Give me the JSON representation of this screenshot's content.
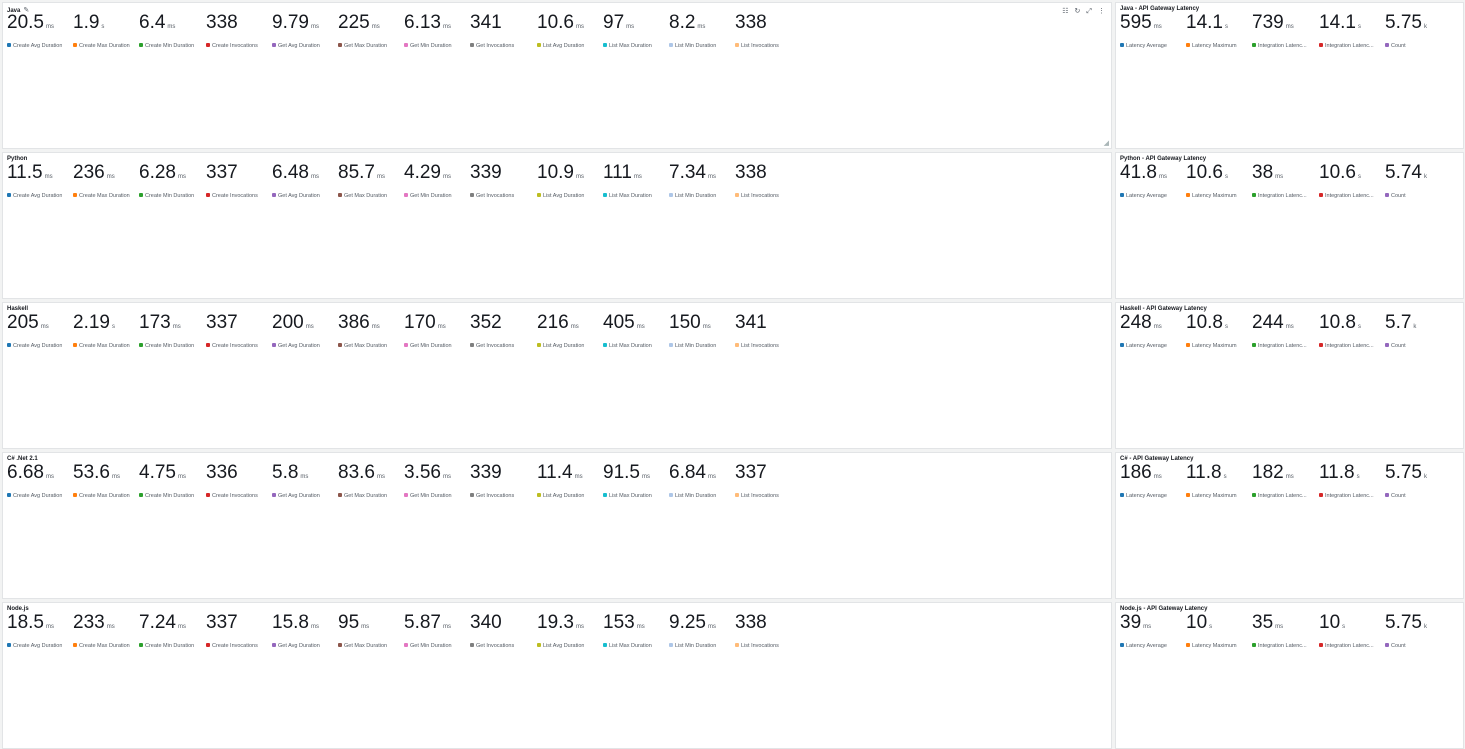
{
  "colors": {
    "c1": "#1f77b4",
    "c2": "#ff7f0e",
    "c3": "#2ca02c",
    "c4": "#d62728",
    "c5": "#9467bd",
    "c6": "#8c564b",
    "c7": "#e377c2",
    "c8": "#7f7f7f",
    "c9": "#bcbd22",
    "c10": "#17becf",
    "c11": "#aec7e8",
    "c12": "#ffbb78"
  },
  "toolbar": {
    "icons": [
      "document-icon",
      "refresh-icon",
      "expand-icon",
      "more-options-icon"
    ],
    "edit_icon": "pencil-icon"
  },
  "lambda_labels": [
    "Create Avg Duration",
    "Create Max Duration",
    "Create Min Duration",
    "Create Invocations",
    "Get Avg Duration",
    "Get Max Duration",
    "Get Min Duration",
    "Get Invocations",
    "List Avg Duration",
    "List Max Duration",
    "List Min Duration",
    "List Invocations"
  ],
  "api_labels": [
    "Latency Average",
    "Latency Maximum",
    "Integration Latenc...",
    "Integration Latenc...",
    "Count"
  ],
  "rows": [
    {
      "lambda": {
        "title": "Java",
        "metrics": [
          {
            "value": "20.5",
            "unit": "ms"
          },
          {
            "value": "1.9",
            "unit": "s"
          },
          {
            "value": "6.4",
            "unit": "ms"
          },
          {
            "value": "338",
            "unit": ""
          },
          {
            "value": "9.79",
            "unit": "ms"
          },
          {
            "value": "225",
            "unit": "ms"
          },
          {
            "value": "6.13",
            "unit": "ms"
          },
          {
            "value": "341",
            "unit": ""
          },
          {
            "value": "10.6",
            "unit": "ms"
          },
          {
            "value": "97",
            "unit": "ms"
          },
          {
            "value": "8.2",
            "unit": "ms"
          },
          {
            "value": "338",
            "unit": ""
          }
        ]
      },
      "api": {
        "title": "Java - API Gateway Latency",
        "metrics": [
          {
            "value": "595",
            "unit": "ms"
          },
          {
            "value": "14.1",
            "unit": "s"
          },
          {
            "value": "739",
            "unit": "ms"
          },
          {
            "value": "14.1",
            "unit": "s"
          },
          {
            "value": "5.75",
            "unit": "k"
          }
        ]
      }
    },
    {
      "lambda": {
        "title": "Python",
        "metrics": [
          {
            "value": "11.5",
            "unit": "ms"
          },
          {
            "value": "236",
            "unit": "ms"
          },
          {
            "value": "6.28",
            "unit": "ms"
          },
          {
            "value": "337",
            "unit": ""
          },
          {
            "value": "6.48",
            "unit": "ms"
          },
          {
            "value": "85.7",
            "unit": "ms"
          },
          {
            "value": "4.29",
            "unit": "ms"
          },
          {
            "value": "339",
            "unit": ""
          },
          {
            "value": "10.9",
            "unit": "ms"
          },
          {
            "value": "111",
            "unit": "ms"
          },
          {
            "value": "7.34",
            "unit": "ms"
          },
          {
            "value": "338",
            "unit": ""
          }
        ]
      },
      "api": {
        "title": "Python - API Gateway Latency",
        "metrics": [
          {
            "value": "41.8",
            "unit": "ms"
          },
          {
            "value": "10.6",
            "unit": "s"
          },
          {
            "value": "38",
            "unit": "ms"
          },
          {
            "value": "10.6",
            "unit": "s"
          },
          {
            "value": "5.74",
            "unit": "k"
          }
        ]
      }
    },
    {
      "lambda": {
        "title": "Haskell",
        "metrics": [
          {
            "value": "205",
            "unit": "ms"
          },
          {
            "value": "2.19",
            "unit": "s"
          },
          {
            "value": "173",
            "unit": "ms"
          },
          {
            "value": "337",
            "unit": ""
          },
          {
            "value": "200",
            "unit": "ms"
          },
          {
            "value": "386",
            "unit": "ms"
          },
          {
            "value": "170",
            "unit": "ms"
          },
          {
            "value": "352",
            "unit": ""
          },
          {
            "value": "216",
            "unit": "ms"
          },
          {
            "value": "405",
            "unit": "ms"
          },
          {
            "value": "150",
            "unit": "ms"
          },
          {
            "value": "341",
            "unit": ""
          }
        ]
      },
      "api": {
        "title": "Haskell - API Gateway Latency",
        "metrics": [
          {
            "value": "248",
            "unit": "ms"
          },
          {
            "value": "10.8",
            "unit": "s"
          },
          {
            "value": "244",
            "unit": "ms"
          },
          {
            "value": "10.8",
            "unit": "s"
          },
          {
            "value": "5.7",
            "unit": "k"
          }
        ]
      }
    },
    {
      "lambda": {
        "title": "C# .Net 2.1",
        "metrics": [
          {
            "value": "6.68",
            "unit": "ms"
          },
          {
            "value": "53.6",
            "unit": "ms"
          },
          {
            "value": "4.75",
            "unit": "ms"
          },
          {
            "value": "336",
            "unit": ""
          },
          {
            "value": "5.8",
            "unit": "ms"
          },
          {
            "value": "83.6",
            "unit": "ms"
          },
          {
            "value": "3.56",
            "unit": "ms"
          },
          {
            "value": "339",
            "unit": ""
          },
          {
            "value": "11.4",
            "unit": "ms"
          },
          {
            "value": "91.5",
            "unit": "ms"
          },
          {
            "value": "6.84",
            "unit": "ms"
          },
          {
            "value": "337",
            "unit": ""
          }
        ]
      },
      "api": {
        "title": "C# - API Gateway Latency",
        "metrics": [
          {
            "value": "186",
            "unit": "ms"
          },
          {
            "value": "11.8",
            "unit": "s"
          },
          {
            "value": "182",
            "unit": "ms"
          },
          {
            "value": "11.8",
            "unit": "s"
          },
          {
            "value": "5.75",
            "unit": "k"
          }
        ]
      }
    },
    {
      "lambda": {
        "title": "Node.js",
        "metrics": [
          {
            "value": "18.5",
            "unit": "ms"
          },
          {
            "value": "233",
            "unit": "ms"
          },
          {
            "value": "7.24",
            "unit": "ms"
          },
          {
            "value": "337",
            "unit": ""
          },
          {
            "value": "15.8",
            "unit": "ms"
          },
          {
            "value": "95",
            "unit": "ms"
          },
          {
            "value": "5.87",
            "unit": "ms"
          },
          {
            "value": "340",
            "unit": ""
          },
          {
            "value": "19.3",
            "unit": "ms"
          },
          {
            "value": "153",
            "unit": "ms"
          },
          {
            "value": "9.25",
            "unit": "ms"
          },
          {
            "value": "338",
            "unit": ""
          }
        ]
      },
      "api": {
        "title": "Node.js - API Gateway Latency",
        "metrics": [
          {
            "value": "39",
            "unit": "ms"
          },
          {
            "value": "10",
            "unit": "s"
          },
          {
            "value": "35",
            "unit": "ms"
          },
          {
            "value": "10",
            "unit": "s"
          },
          {
            "value": "5.75",
            "unit": "k"
          }
        ]
      }
    }
  ]
}
